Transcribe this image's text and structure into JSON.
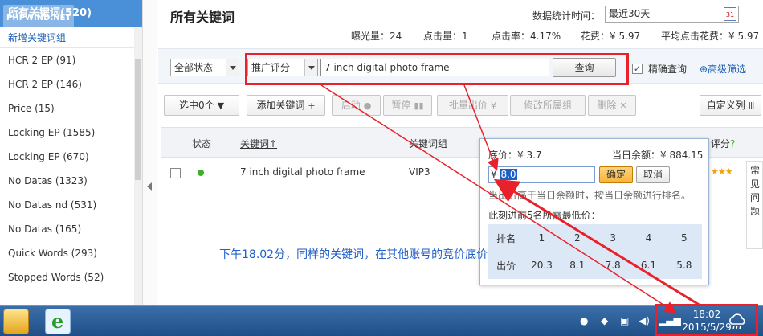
{
  "sidebar": {
    "header": "所有关键词(520)",
    "watermark": "PHPWIND.NET",
    "new_group": "新增关键词组",
    "items": [
      {
        "label": "HCR 2 EP (91)"
      },
      {
        "label": "HCR 2 EP (146)"
      },
      {
        "label": "Price (15)"
      },
      {
        "label": "Locking EP (1585)"
      },
      {
        "label": "Locking EP (670)"
      },
      {
        "label": "No Datas (1323)"
      },
      {
        "label": "No Datas nd (531)"
      },
      {
        "label": "No Datas (165)"
      },
      {
        "label": "Quick Words (293)"
      },
      {
        "label": "Stopped Words (52)"
      }
    ]
  },
  "main": {
    "title": "所有关键词",
    "period_label": "数据统计时间：",
    "period_value": "最近30天",
    "calendar_day": "31",
    "stats": {
      "impressions": "曝光量：24",
      "clicks": "点击量：1",
      "ctr": "点击率：4.17%",
      "cost": "花费：¥ 5.97",
      "avg_cpc": "平均点击花费：¥ 5.97"
    },
    "filter": {
      "status": "全部状态",
      "sort": "推广评分",
      "keyword": "7 inch digital photo frame",
      "query_button": "查询",
      "exact_label": "精确查询",
      "exact_checked": "✓",
      "advanced": "⊕高级筛选"
    },
    "toolbar": {
      "select": "选中0个",
      "add": "添加关键词",
      "start": "启动",
      "pause": "暂停",
      "batch_bid": "批量出价",
      "modify_group": "修改所属组",
      "delete": "删除",
      "custom_columns": "自定义列"
    },
    "table": {
      "headers": {
        "status": "状态",
        "keyword": "关键词",
        "group": "关键词组",
        "score": "评分"
      },
      "rows": [
        {
          "keyword": "7 inch digital photo frame",
          "group": "VIP3",
          "stars": "★★★"
        }
      ]
    },
    "side_panel_text": "常见问题"
  },
  "popup": {
    "floor_price": "底价：¥ 3.7",
    "balance": "当日余额：¥ 884.15",
    "currency": "¥",
    "bid_value": "8.0",
    "confirm": "确定",
    "cancel": "取消",
    "note": "当出价高于当日余额时，按当日余额进行排名。",
    "top5_label": "此刻进前5名所需最低价：",
    "rank_label": "排名",
    "bid_label": "出价",
    "ranks": [
      "1",
      "2",
      "3",
      "4",
      "5"
    ],
    "bids": [
      "20.3",
      "8.1",
      "7.8",
      "6.1",
      "5.8"
    ]
  },
  "annotation": "下午18.02分，同样的关键词，在其他账号的竞价底价",
  "taskbar": {
    "time": "18:02",
    "date": "2015/5/29"
  },
  "colors": {
    "highlight": "#e8212b",
    "annotation": "#1f5fc9",
    "sidebar_header": "#4a90d9"
  }
}
